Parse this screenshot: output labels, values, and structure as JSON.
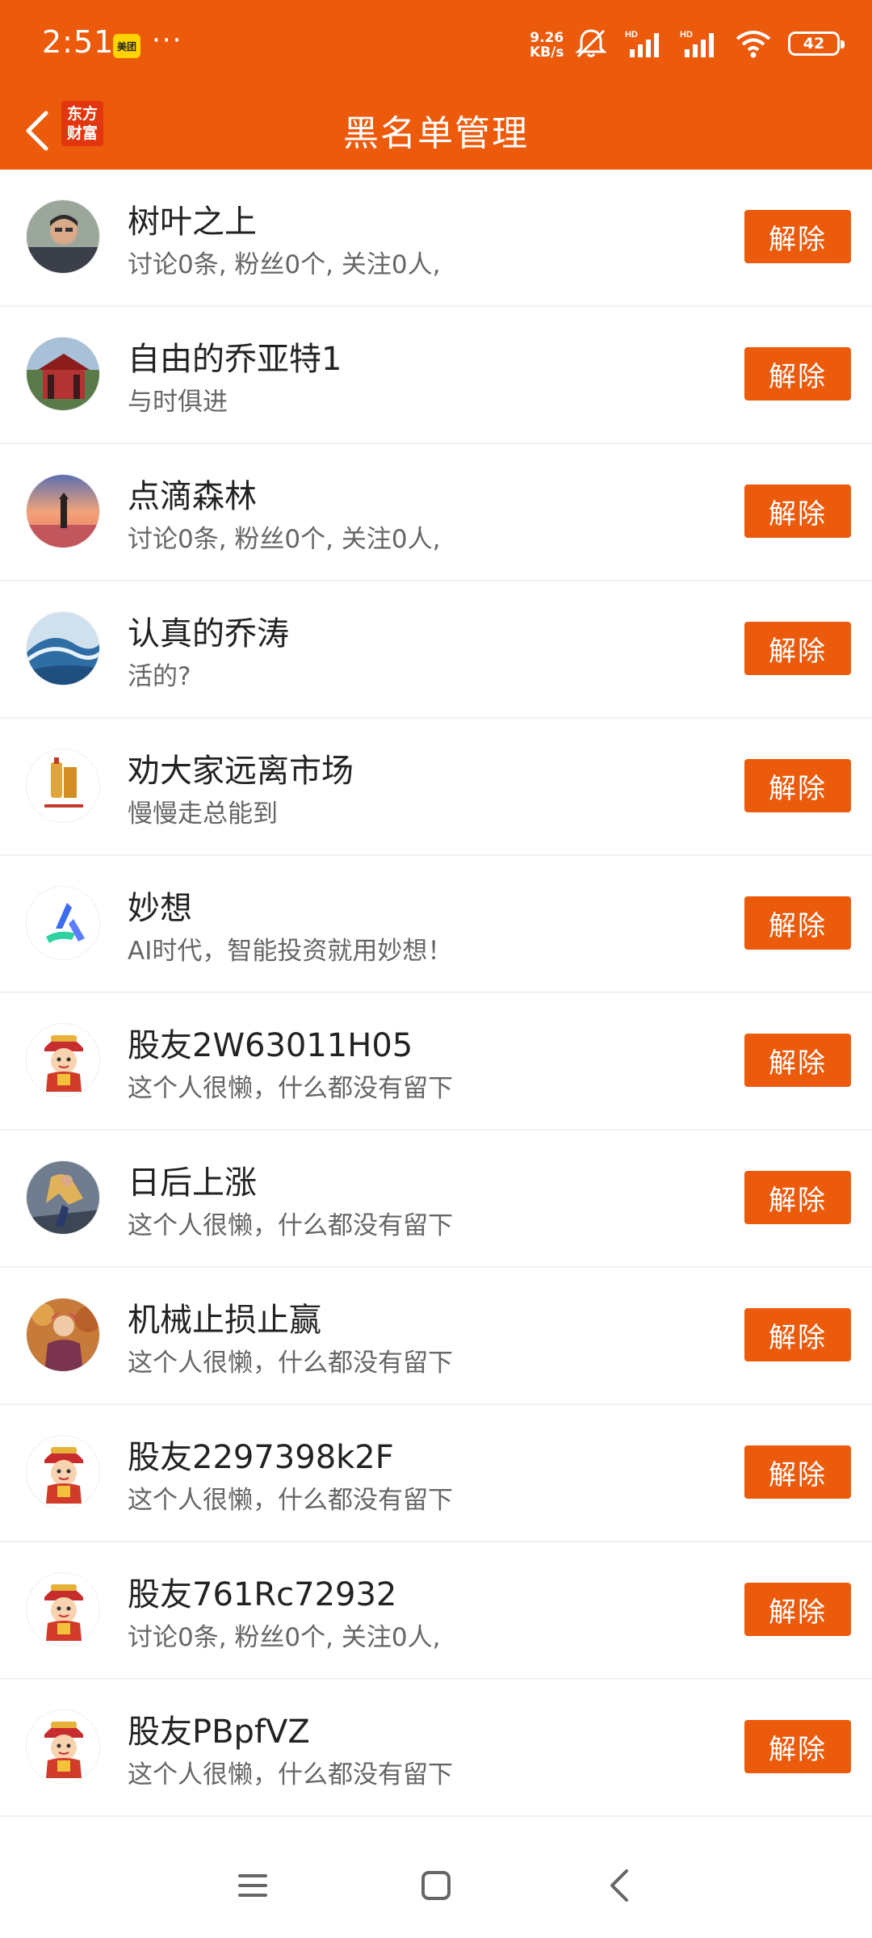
{
  "status_bar": {
    "time": "2:51",
    "app_badge": "美团",
    "more_dots": "···",
    "net_speed_value": "9.26",
    "net_speed_unit": "KB/s",
    "battery": "42"
  },
  "header": {
    "title": "黑名单管理",
    "logo_line1": "东方",
    "logo_line2": "财富"
  },
  "button_label": "解除",
  "users": [
    {
      "name": "树叶之上",
      "desc": "讨论0条, 粉丝0个, 关注0人,",
      "avatar": "man-photo"
    },
    {
      "name": "自由的乔亚特1",
      "desc": "与时俱进",
      "avatar": "pavilion-photo"
    },
    {
      "name": "点滴森林",
      "desc": "讨论0条, 粉丝0个, 关注0人,",
      "avatar": "lighthouse-sunset"
    },
    {
      "name": "认真的乔涛",
      "desc": "活的?",
      "avatar": "ocean-wave"
    },
    {
      "name": "劝大家远离市场",
      "desc": "慢慢走总能到",
      "avatar": "liquor-ad"
    },
    {
      "name": "妙想",
      "desc": "AI时代，智能投资就用妙想！",
      "avatar": "miaoxiang-logo"
    },
    {
      "name": "股友2W63011H05",
      "desc": "这个人很懒，什么都没有留下",
      "avatar": "default-mascot"
    },
    {
      "name": "日后上涨",
      "desc": "这个人很懒，什么都没有留下",
      "avatar": "fighter-art"
    },
    {
      "name": "机械止损止赢",
      "desc": "这个人很懒，什么都没有留下",
      "avatar": "girl-autumn"
    },
    {
      "name": "股友2297398k2F",
      "desc": "这个人很懒，什么都没有留下",
      "avatar": "default-mascot"
    },
    {
      "name": "股友761Rc72932",
      "desc": "讨论0条, 粉丝0个, 关注0人,",
      "avatar": "default-mascot"
    },
    {
      "name": "股友PBpfVZ",
      "desc": "这个人很懒，什么都没有留下",
      "avatar": "default-mascot"
    }
  ],
  "colors": {
    "brand": "#ec5a0c",
    "text_primary": "#222222",
    "text_secondary": "#666666"
  }
}
